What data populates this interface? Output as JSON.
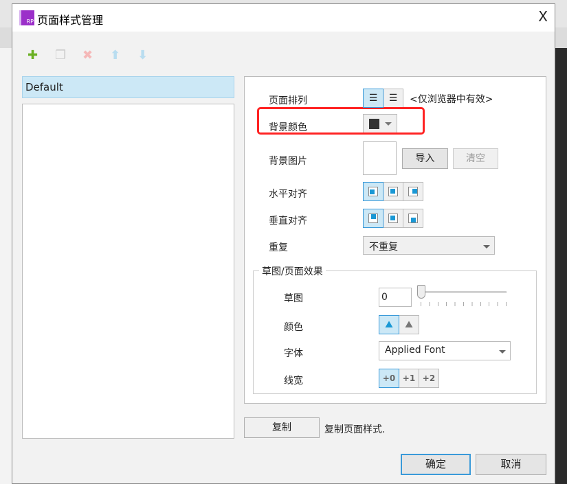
{
  "dialog": {
    "title": "页面样式管理",
    "logo": "RP",
    "close": "X"
  },
  "toolbar": {
    "icons": [
      "add-icon",
      "duplicate-icon",
      "delete-icon",
      "move-up-icon",
      "move-down-icon"
    ]
  },
  "styles_list": {
    "selected": "Default"
  },
  "settings": {
    "page_align_label": "页面排列",
    "page_align_note": "<仅浏览器中有效>",
    "bg_color_label": "背景颜色",
    "bg_color_value": "#333333",
    "bg_image_label": "背景图片",
    "import_label": "导入",
    "clear_label": "清空",
    "h_align_label": "水平对齐",
    "v_align_label": "垂直对齐",
    "repeat_label": "重复",
    "repeat_value": "不重复",
    "sketch_group": "草图/页面效果",
    "sketch_label": "草图",
    "sketch_value": "0",
    "color_label": "颜色",
    "font_label": "字体",
    "font_value": "Applied Font",
    "line_width_label": "线宽",
    "line_widths": [
      "+0",
      "+1",
      "+2"
    ]
  },
  "footer": {
    "copy_label": "复制",
    "copy_desc": "复制页面样式.",
    "ok_label": "确定",
    "cancel_label": "取消"
  },
  "colors": {
    "accent": "#3a9ad9",
    "highlight": "#ff2222"
  }
}
